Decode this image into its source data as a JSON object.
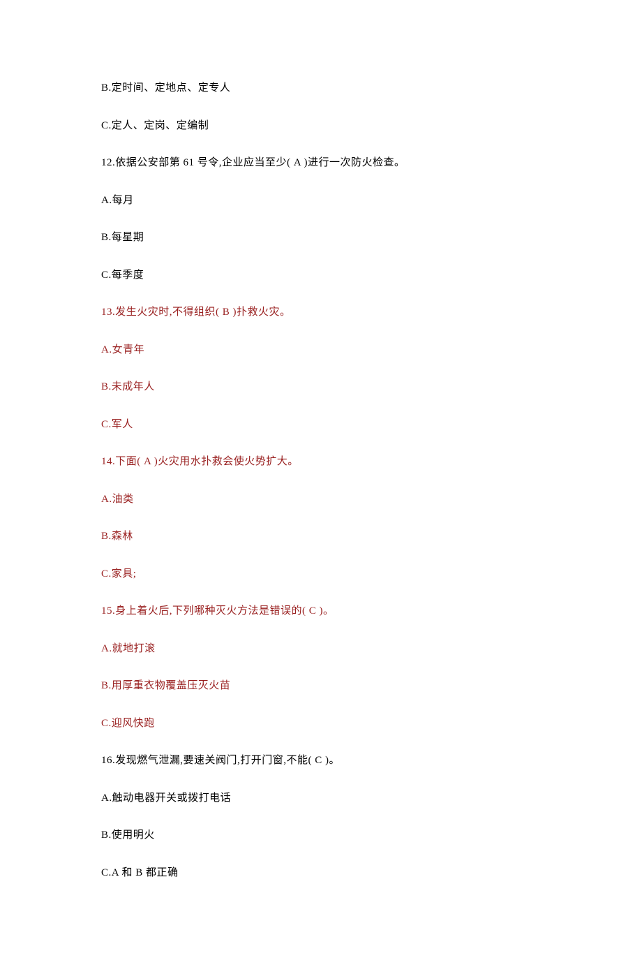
{
  "lines": [
    {
      "text": "B.定时间、定地点、定专人",
      "color": "black"
    },
    {
      "text": "C.定人、定岗、定编制",
      "color": "black"
    },
    {
      "text": "12.依据公安部第 61 号令,企业应当至少( A )进行一次防火检查。",
      "color": "black"
    },
    {
      "text": "A.每月",
      "color": "black"
    },
    {
      "text": "B.每星期",
      "color": "black"
    },
    {
      "text": "C.每季度",
      "color": "black"
    },
    {
      "text": "13.发生火灾时,不得组织( B )扑救火灾。",
      "color": "red"
    },
    {
      "text": "A.女青年",
      "color": "red"
    },
    {
      "text": "B.未成年人",
      "color": "red"
    },
    {
      "text": "C.军人",
      "color": "red"
    },
    {
      "text": "14.下面( A )火灾用水扑救会使火势扩大。",
      "color": "red"
    },
    {
      "text": "A.油类",
      "color": "red"
    },
    {
      "text": "B.森林",
      "color": "red"
    },
    {
      "text": "C.家具;",
      "color": "red"
    },
    {
      "text": "15.身上着火后,下列哪种灭火方法是错误的( C )。",
      "color": "red"
    },
    {
      "text": "A.就地打滚",
      "color": "red"
    },
    {
      "text": "B.用厚重衣物覆盖压灭火苗",
      "color": "red"
    },
    {
      "text": "C.迎风快跑",
      "color": "red"
    },
    {
      "text": "16.发现燃气泄漏,要速关阀门,打开门窗,不能( C )。",
      "color": "black"
    },
    {
      "text": "A.触动电器开关或拨打电话",
      "color": "black"
    },
    {
      "text": "B.使用明火",
      "color": "black"
    },
    {
      "text": "C.A 和 B 都正确",
      "color": "black"
    }
  ]
}
